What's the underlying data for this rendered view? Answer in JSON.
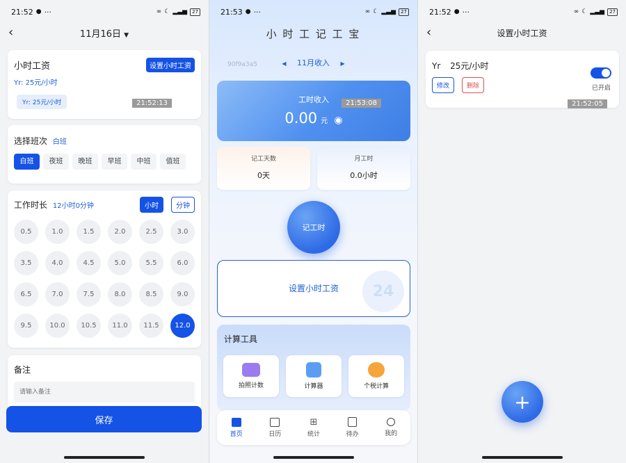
{
  "status_bar": {
    "time_left": "21:52",
    "time_mid": "21:53",
    "time_right": "21:52",
    "extra": "···",
    "battery": "27"
  },
  "left": {
    "date_title": "11月16日",
    "wage_card": {
      "title": "小时工资",
      "set_button": "设置小时工资",
      "rate_line": "Yr: 25元/小时",
      "chip": "Yr: 25元/小时",
      "timestamp": "21:52:13"
    },
    "shift_card": {
      "title": "选择班次",
      "selected": "白班",
      "options": [
        "白班",
        "夜班",
        "晚班",
        "早班",
        "中班",
        "值班"
      ]
    },
    "duration_card": {
      "title": "工作时长",
      "value": "12小时0分钟",
      "unit_hour": "小时",
      "unit_minute": "分钟",
      "hours": [
        "0.5",
        "1.0",
        "1.5",
        "2.0",
        "2.5",
        "3.0",
        "3.5",
        "4.0",
        "4.5",
        "5.0",
        "5.5",
        "6.0",
        "6.5",
        "7.0",
        "7.5",
        "8.0",
        "8.5",
        "9.0",
        "9.5",
        "10.0",
        "10.5",
        "11.0",
        "11.5",
        "12.0"
      ],
      "selected": "12.0"
    },
    "note_card": {
      "title": "备注",
      "placeholder": "请输入备注"
    },
    "save_button": "保存"
  },
  "middle": {
    "app_title": "小 时 工 记 工 宝",
    "watermark": "90f9a3a5",
    "month": "11月收入",
    "income_card": {
      "label": "工时收入",
      "amount": "0.00",
      "unit": "元",
      "timestamp": "21:53:08"
    },
    "stats": [
      {
        "label": "记工天数",
        "value": "0天"
      },
      {
        "label": "月工时",
        "value": "0.0小时"
      }
    ],
    "record_button": "记工时",
    "set_wage_button": "设置小时工资",
    "tools_title": "计算工具",
    "tools": [
      {
        "label": "拍照计数",
        "icon": "camera-icon"
      },
      {
        "label": "计算器",
        "icon": "calculator-icon"
      },
      {
        "label": "个税计算",
        "icon": "coins-icon"
      }
    ],
    "tabs": [
      "首页",
      "日历",
      "统计",
      "待办",
      "我的"
    ]
  },
  "right": {
    "page_title": "设置小时工资",
    "wage_item": {
      "name": "Yr",
      "rate": "25元/小时",
      "edit": "修改",
      "delete": "删除",
      "status": "已开启",
      "timestamp": "21:52:05"
    },
    "add_button": "+"
  },
  "colors": {
    "accent": "#1553e6",
    "delete": "#d9534f"
  }
}
